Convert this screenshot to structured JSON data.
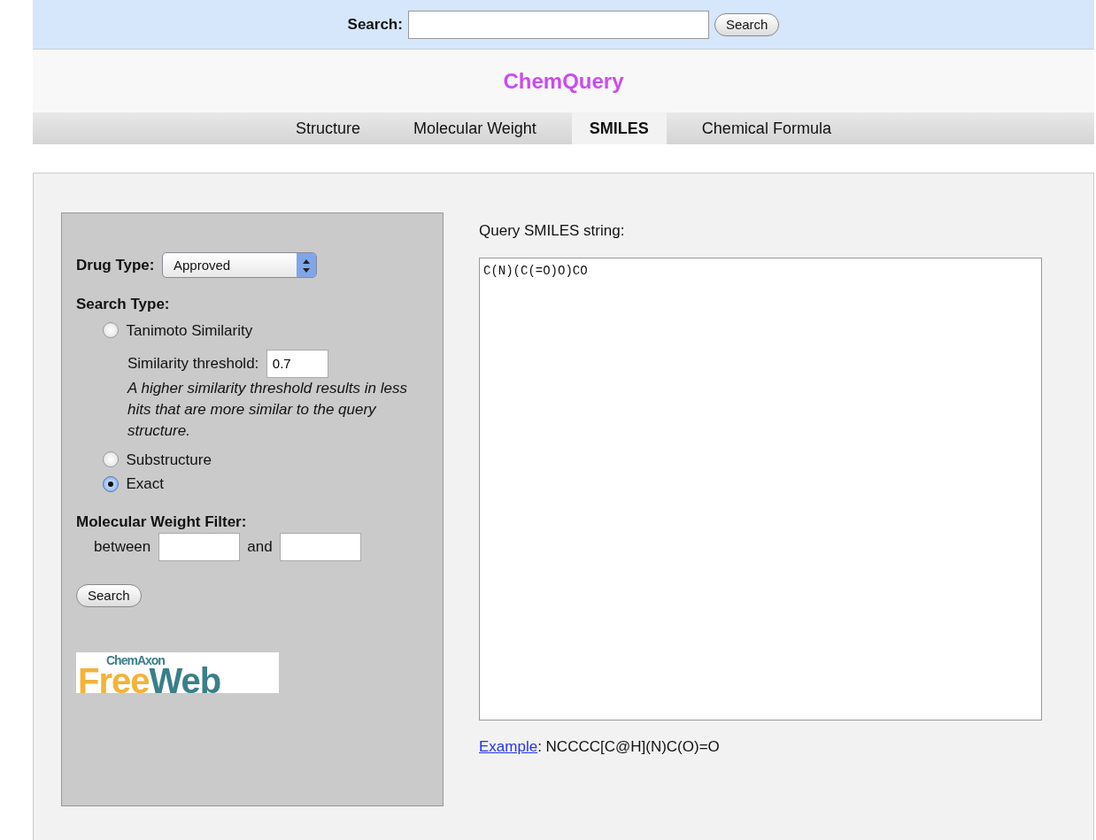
{
  "search_bar": {
    "label": "Search:",
    "button": "Search"
  },
  "title": "ChemQuery",
  "tabs": [
    {
      "label": "Structure",
      "selected": false
    },
    {
      "label": "Molecular Weight",
      "selected": false
    },
    {
      "label": "SMILES",
      "selected": true
    },
    {
      "label": "Chemical Formula",
      "selected": false
    }
  ],
  "form": {
    "drug_type": {
      "label": "Drug Type:",
      "value": "Approved"
    },
    "search_type": {
      "label": "Search Type:",
      "options": [
        {
          "label": "Tanimoto Similarity",
          "selected": false,
          "threshold": {
            "label": "Similarity threshold:",
            "value": "0.7"
          },
          "note": "A higher similarity threshold results in less hits that are more similar to the query structure."
        },
        {
          "label": "Substructure",
          "selected": false
        },
        {
          "label": "Exact",
          "selected": true
        }
      ]
    },
    "mw_filter": {
      "label": "Molecular Weight Filter:",
      "between": "between",
      "and": "and"
    },
    "button": "Search",
    "logo": {
      "small": "ChemAxon",
      "left": "Free",
      "right": "Web"
    }
  },
  "query": {
    "label": "Query SMILES string:",
    "value": "C(N)(C(=O)O)CO",
    "example_link": "Example",
    "example_text": ": NCCCC[C@H](N)C(O)=O"
  }
}
